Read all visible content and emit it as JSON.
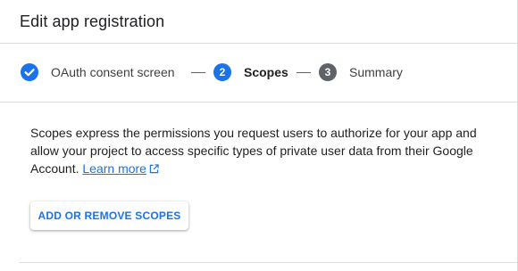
{
  "header": {
    "title": "Edit app registration"
  },
  "stepper": {
    "steps": [
      {
        "label": "OAuth consent screen",
        "marker": "",
        "state": "complete",
        "icon": "check-circle-icon"
      },
      {
        "label": "Scopes",
        "marker": "2",
        "state": "active"
      },
      {
        "label": "Summary",
        "marker": "3",
        "state": "upcoming"
      }
    ]
  },
  "scopes": {
    "description": "Scopes express the permissions you request users to authorize for your app and allow your project to access specific types of private user data from their Google Account.",
    "learn_more": "Learn more",
    "learn_more_icon": "external-link-icon",
    "add_button": "ADD OR REMOVE SCOPES"
  },
  "colors": {
    "accent": "#1a73e8",
    "upcoming": "#5f6368",
    "divider": "#dadce0"
  }
}
